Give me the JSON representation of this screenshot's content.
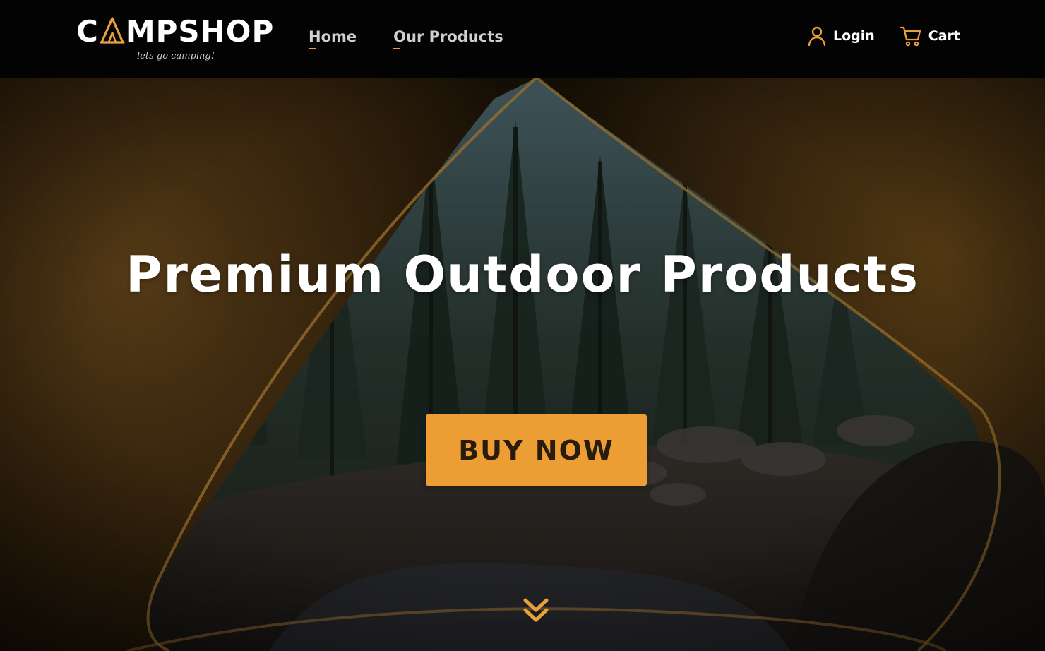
{
  "brand": {
    "name_before": "C",
    "name_after": "MPSHOP",
    "tagline": "lets go camping!",
    "logo_icon": "tent-a-icon"
  },
  "nav": {
    "items": [
      {
        "label": "Home"
      },
      {
        "label": "Our Products"
      }
    ]
  },
  "account": {
    "login_label": "Login",
    "login_icon": "user-icon",
    "cart_label": "Cart",
    "cart_icon": "cart-icon"
  },
  "hero": {
    "title": "Premium Outdoor Products",
    "cta_label": "BUY NOW",
    "scroll_icon": "double-chevron-down-icon"
  },
  "colors": {
    "accent": "#ec9e34",
    "header_bg": "#030303",
    "text_light": "#ffffff",
    "nav_text": "#cfcfcf"
  }
}
